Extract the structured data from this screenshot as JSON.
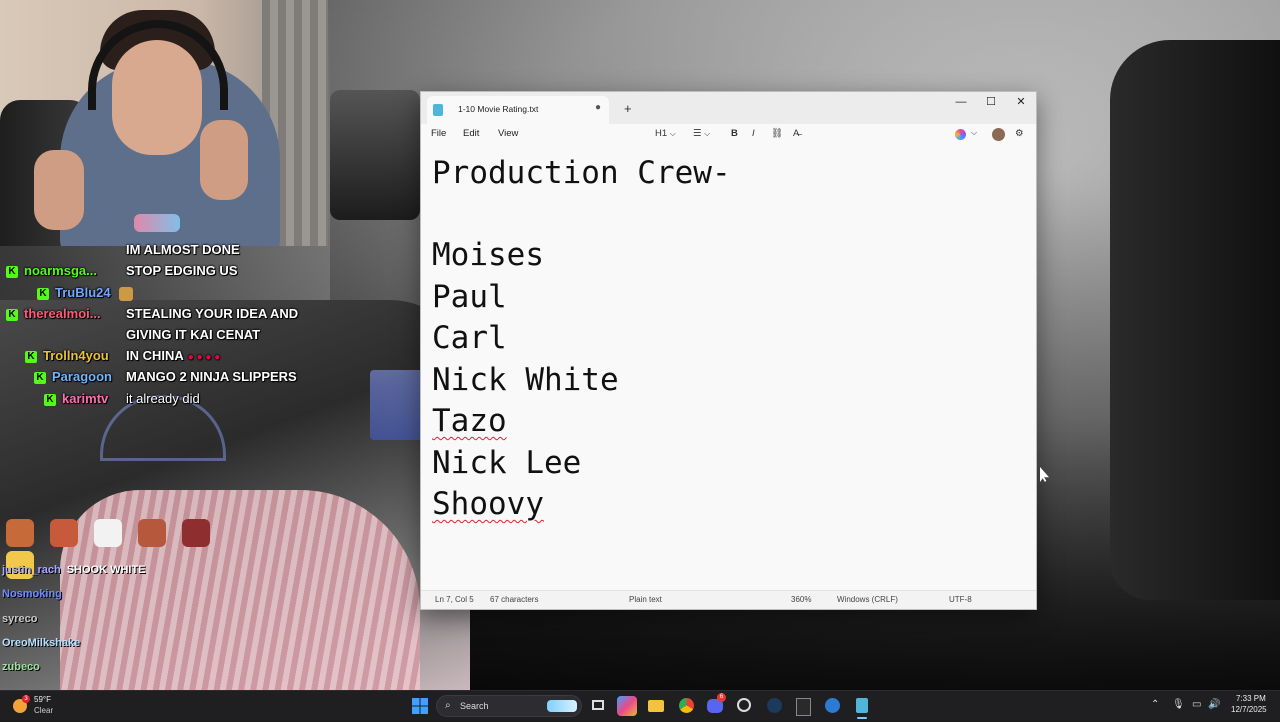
{
  "chat": [
    {
      "user": "",
      "user_color": "#ffffff",
      "message": "IM ALMOST DONE",
      "badge": false
    },
    {
      "user": "noarmsga...",
      "user_color": "#53fc18",
      "message": "STOP EDGING US",
      "badge": true
    },
    {
      "user": "TruBlu24",
      "user_color": "#6fa8ff",
      "message": "",
      "badge": true,
      "emote": true
    },
    {
      "user": "therealmoi...",
      "user_color": "#ff5a7a",
      "message": "STEALING YOUR IDEA AND",
      "badge": true
    },
    {
      "user": "",
      "user_color": "#ffffff",
      "message": "GIVING IT KAI CENAT",
      "badge": false
    },
    {
      "user": "Trolln4you",
      "user_color": "#e8c23a",
      "message": "IN CHINA",
      "badge": true,
      "dots": "● ● ● ●"
    },
    {
      "user": "Paragoon",
      "user_color": "#6fb6ff",
      "message": "MANGO 2 NINJA SLIPPERS",
      "badge": true
    },
    {
      "user": "karimtv",
      "user_color": "#ff6fb0",
      "message": "it already did",
      "badge": true
    }
  ],
  "badge_letter": "K",
  "chat2": [
    {
      "user": "justin_rach",
      "user_color": "#a8a8ff",
      "message": "SHOOK WHITE"
    },
    {
      "user": "Nosmoking",
      "user_color": "#6f8cff",
      "message": ""
    },
    {
      "user": "syreco",
      "user_color": "#c9c9c9",
      "message": ""
    },
    {
      "user": "OreoMilkshake",
      "user_color": "#b8e0ff",
      "message": ""
    },
    {
      "user": "zubeco",
      "user_color": "#9fe29f",
      "message": ""
    }
  ],
  "notepad": {
    "tab_title": "1-10 Movie Rating.txt",
    "tab_modified": "●",
    "new_tab": "+",
    "window_buttons": {
      "minimize": "—",
      "maximize": "☐",
      "close": "✕"
    },
    "menus": {
      "file": "File",
      "edit": "Edit",
      "view": "View"
    },
    "toolbar": {
      "heading": "H1",
      "heading_caret": "⌵",
      "list": "☰",
      "list_caret": "⌵",
      "bold": "B",
      "italic": "I",
      "link": "⛓",
      "clear_format": "A̶",
      "copilot_caret": "⌵",
      "settings": "⚙"
    },
    "lines": [
      "Production Crew-",
      "",
      "Moises",
      "Paul",
      "Carl",
      "Nick White",
      "Tazo",
      "Nick Lee",
      "Shoovy"
    ],
    "misspelled": [
      "Tazo",
      "Shoovy"
    ],
    "status": {
      "position": "Ln 7, Col 5",
      "characters": "67 characters",
      "format": "Plain text",
      "zoom": "360%",
      "line_ending": "Windows (CRLF)",
      "encoding": "UTF-8"
    }
  },
  "taskbar": {
    "weather_temp": "59°F",
    "weather_desc": "Clear",
    "weather_badge": "3",
    "search_placeholder": "Search",
    "start_icon": "windows-logo",
    "discord_badge": "6",
    "time": "7:33 PM",
    "date": "12/7/2025",
    "tray_chevron": "⌃"
  }
}
